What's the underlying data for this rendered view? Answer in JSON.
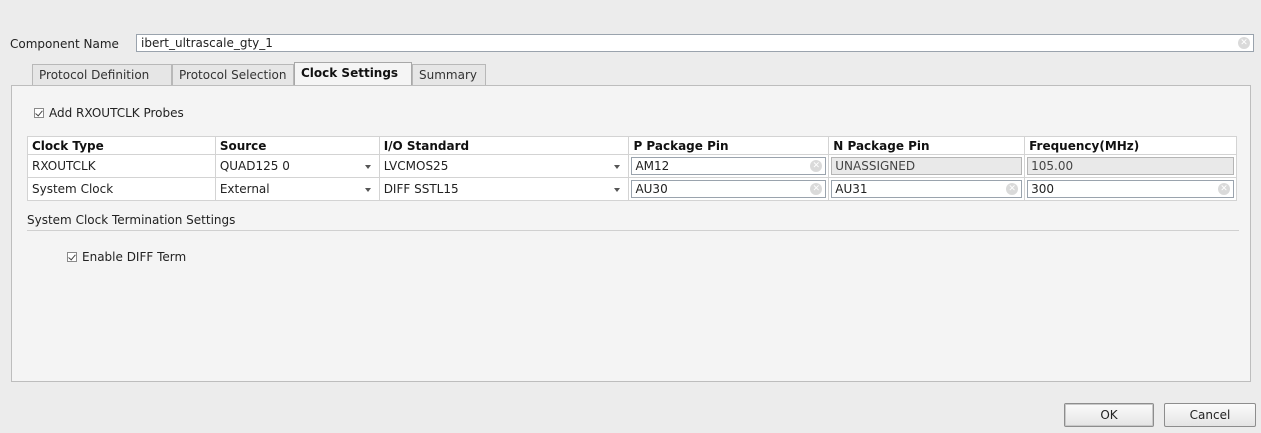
{
  "component": {
    "label": "Component Name",
    "value": "ibert_ultrascale_gty_1"
  },
  "tabs": [
    {
      "label": "Protocol Definition",
      "active": false
    },
    {
      "label": "Protocol Selection",
      "active": false
    },
    {
      "label": "Clock Settings",
      "active": true
    },
    {
      "label": "Summary",
      "active": false
    }
  ],
  "panel": {
    "add_probes_label": "Add RXOUTCLK Probes",
    "add_probes_checked": true,
    "table": {
      "headers": [
        "Clock Type",
        "Source",
        "I/O Standard",
        "P Package Pin",
        "N Package Pin",
        "Frequency(MHz)"
      ],
      "rows": [
        {
          "clock_type": "RXOUTCLK",
          "source": "QUAD125 0",
          "io_standard": "LVCMOS25",
          "p_pin": "AM12",
          "n_pin": "UNASSIGNED",
          "frequency": "105.00"
        },
        {
          "clock_type": "System Clock",
          "source": "External",
          "io_standard": "DIFF SSTL15",
          "p_pin": "AU30",
          "n_pin": "AU31",
          "frequency": "300"
        }
      ]
    },
    "termination_section_label": "System Clock Termination Settings",
    "enable_diff_term_label": "Enable DIFF Term",
    "enable_diff_term_checked": true
  },
  "buttons": {
    "ok": "OK",
    "cancel": "Cancel"
  }
}
